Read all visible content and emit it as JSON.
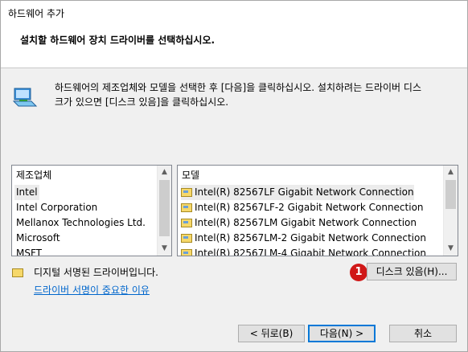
{
  "window": {
    "title": "하드웨어 추가"
  },
  "header": {
    "text": "설치할 하드웨어 장치 드라이버를 선택하십시오."
  },
  "instruction": {
    "line1": "하드웨어의 제조업체와 모델을 선택한 후 [다음]을 클릭하십시오. 설치하려는 드라이버 디스",
    "line2": "크가 있으면 [디스크 있음]을 클릭하십시오."
  },
  "manufacturers": {
    "header": "제조업체",
    "items": [
      "Intel",
      "Intel Corporation",
      "Mellanox Technologies Ltd.",
      "Microsoft",
      "MSFT"
    ],
    "selected": "Intel"
  },
  "models": {
    "header": "모델",
    "items": [
      "Intel(R) 82567LF Gigabit Network Connection",
      "Intel(R) 82567LF-2 Gigabit Network Connection",
      "Intel(R) 82567LM Gigabit Network Connection",
      "Intel(R) 82567LM-2 Gigabit Network Connection",
      "Intel(R) 82567LM-4 Gigabit Network Connection"
    ],
    "selected": "Intel(R) 82567LF Gigabit Network Connection"
  },
  "signature": {
    "status": "디지털 서명된 드라이버입니다.",
    "link": "드라이버 서명이 중요한 이유"
  },
  "badge": "1",
  "buttons": {
    "have_disk": "디스크 있음(H)...",
    "back": "< 뒤로(B)",
    "next": "다음(N) >",
    "cancel": "취소"
  }
}
